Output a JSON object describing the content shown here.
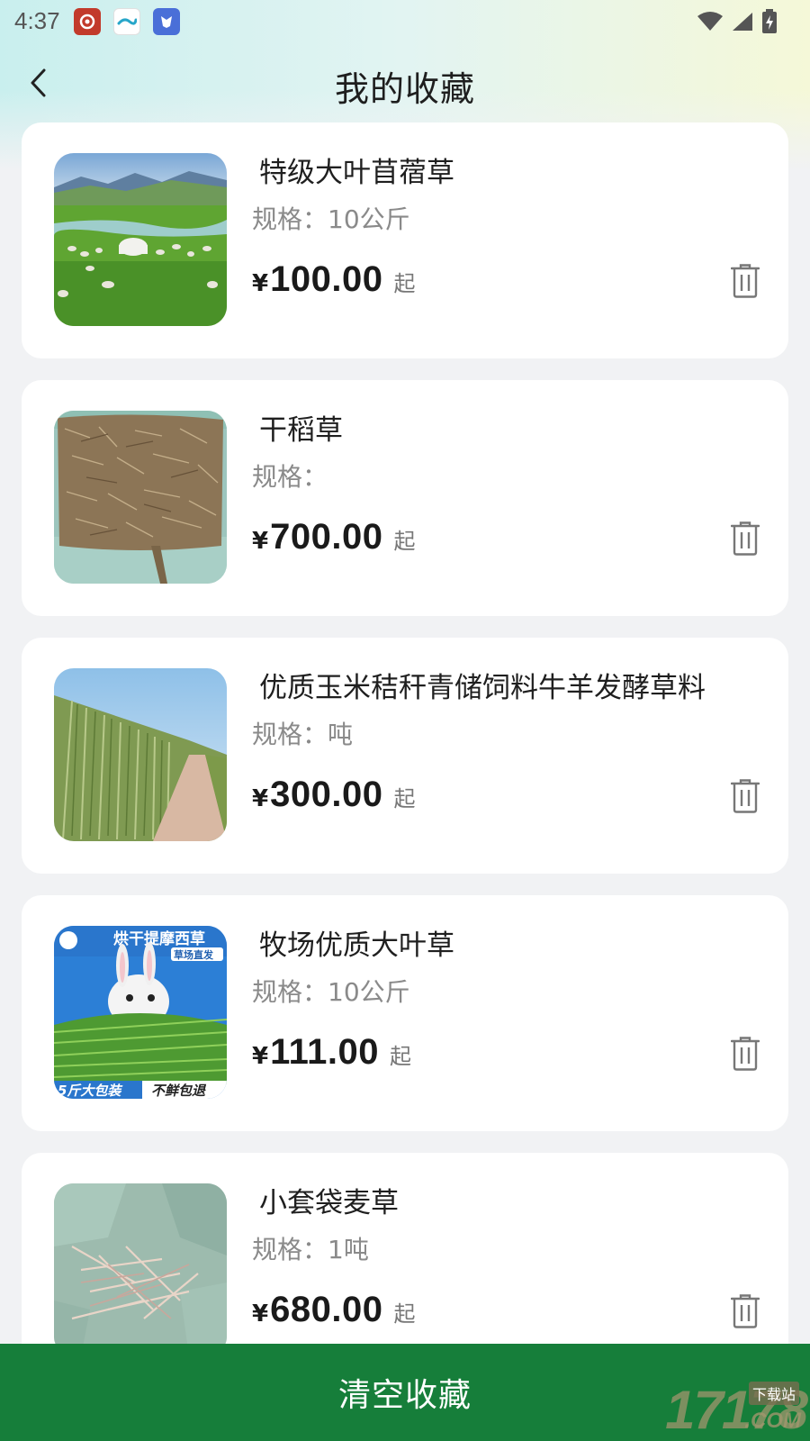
{
  "status_bar": {
    "time": "4:37"
  },
  "header": {
    "title": "我的收藏"
  },
  "favorites": [
    {
      "title": "特级大叶苜蓿草",
      "spec": "规格：10公斤",
      "currency": "¥",
      "price": "100.00",
      "price_suffix": "起",
      "image": "grassland-with-sheep-and-yurt"
    },
    {
      "title": "干稻草",
      "spec": "规格：",
      "currency": "¥",
      "price": "700.00",
      "price_suffix": "起",
      "image": "baled-rice-straw"
    },
    {
      "title": "优质玉米秸秆青储饲料牛羊发酵草料",
      "spec": "规格：吨",
      "currency": "¥",
      "price": "300.00",
      "price_suffix": "起",
      "image": "corn-stalk-field-with-path"
    },
    {
      "title": "牧场优质大叶草",
      "spec": "规格：10公斤",
      "currency": "¥",
      "price": "111.00",
      "price_suffix": "起",
      "image": "rabbit-eating-timothy-hay-ad",
      "image_text": {
        "banner": "烘干提摩西草",
        "badge": "草场直发",
        "bottom_left": "5斤大包装",
        "bottom_right": "不鲜包退"
      }
    },
    {
      "title": "小套袋麦草",
      "spec": "规格：1吨",
      "currency": "¥",
      "price": "680.00",
      "price_suffix": "起",
      "image": "shredded-wheat-straw-bags"
    }
  ],
  "footer": {
    "clear_button": "清空收藏"
  },
  "watermark": {
    "number": "17178",
    "tag": "下载站",
    "domain": ".COM"
  },
  "colors": {
    "primary_green": "#167e3a",
    "card_bg": "#ffffff",
    "page_bg": "#f1f2f4"
  }
}
